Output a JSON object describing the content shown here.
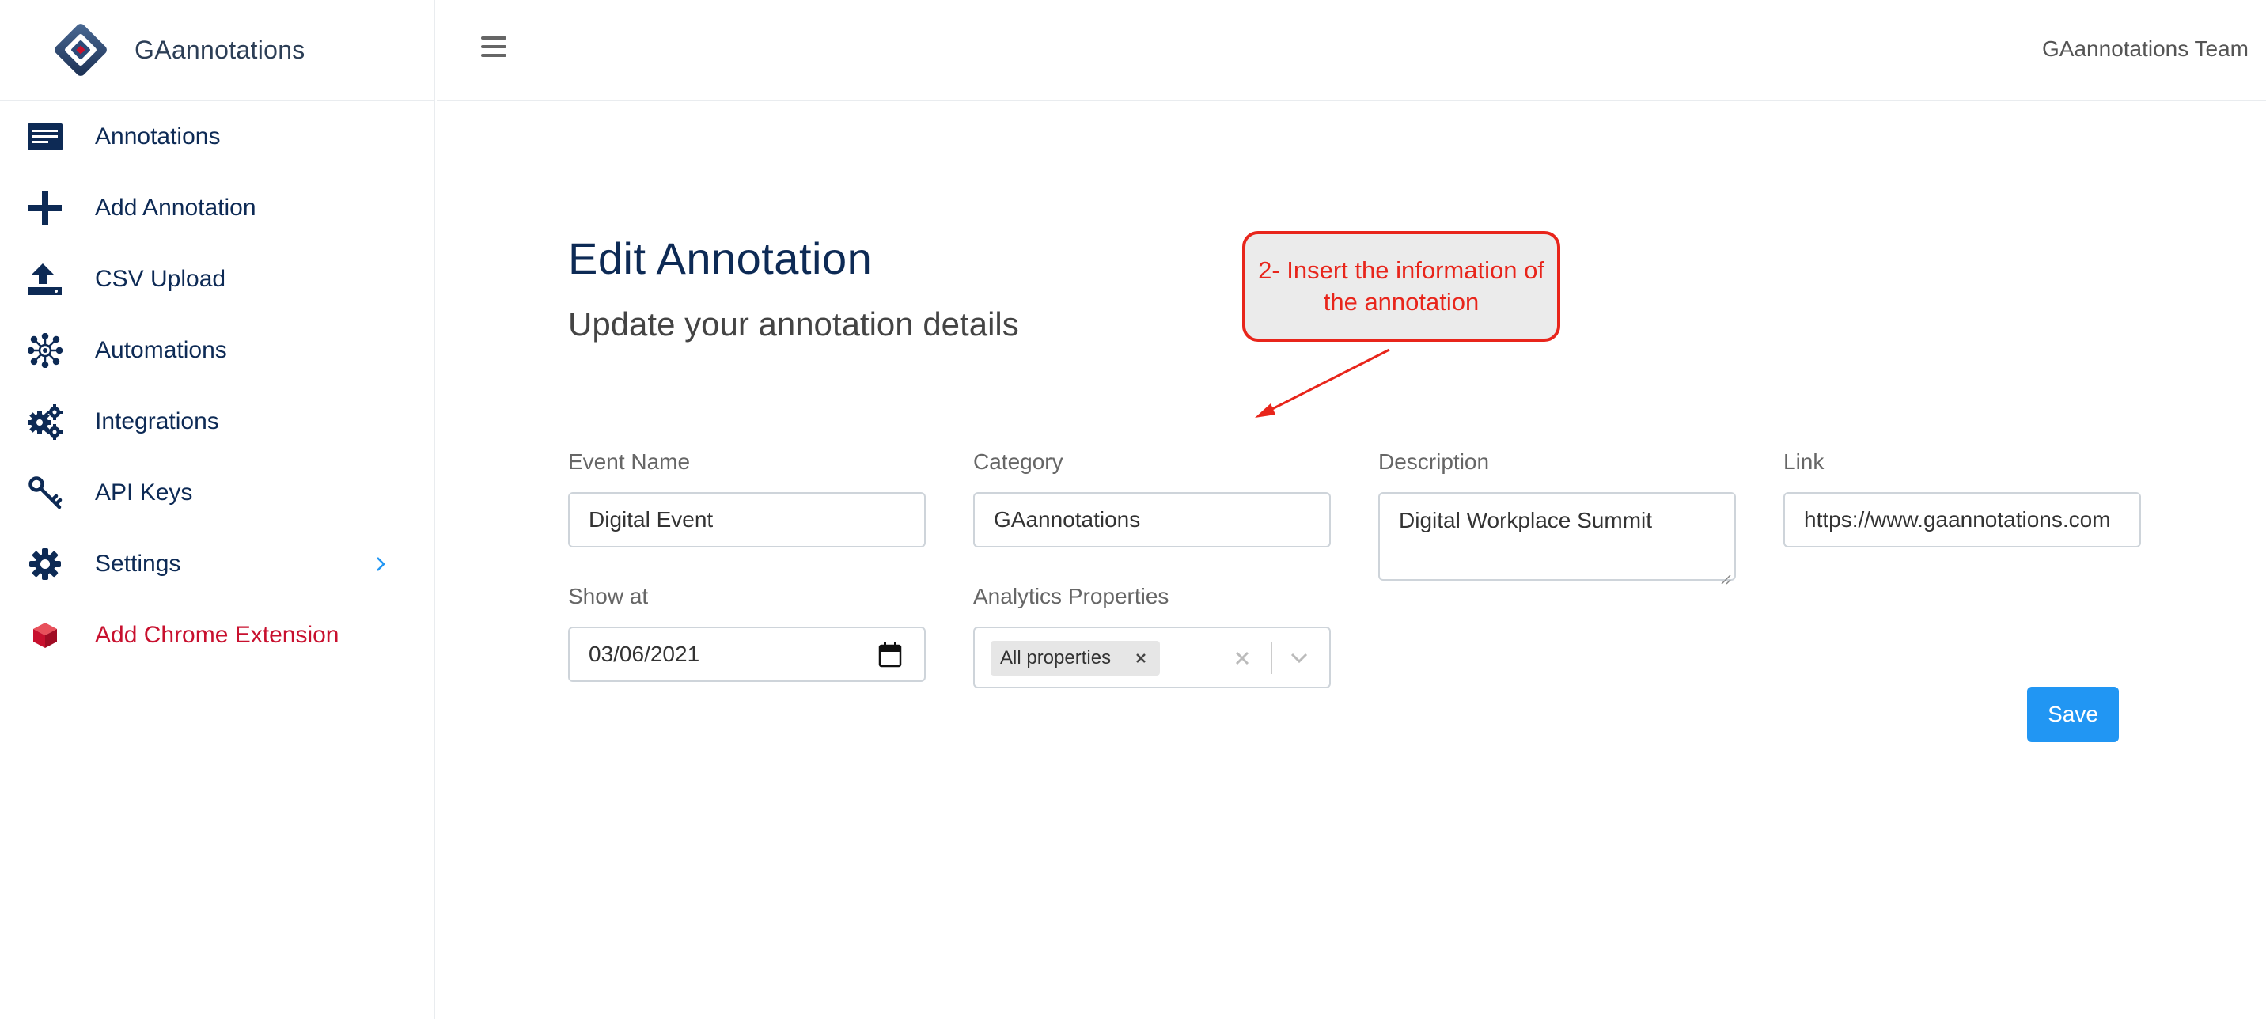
{
  "app": {
    "brand_name": "GAannotations",
    "team_name": "GAannotations Team"
  },
  "sidebar": {
    "items": [
      {
        "label": "Annotations",
        "icon": "list-icon"
      },
      {
        "label": "Add Annotation",
        "icon": "plus-icon"
      },
      {
        "label": "CSV Upload",
        "icon": "upload-icon"
      },
      {
        "label": "Automations",
        "icon": "network-icon"
      },
      {
        "label": "Integrations",
        "icon": "gears-icon"
      },
      {
        "label": "API Keys",
        "icon": "key-icon"
      },
      {
        "label": "Settings",
        "icon": "gear-icon"
      },
      {
        "label": "Add Chrome Extension",
        "icon": "cube-icon"
      }
    ]
  },
  "page": {
    "title": "Edit Annotation",
    "subtitle": "Update your annotation details"
  },
  "form": {
    "event_name": {
      "label": "Event Name",
      "value": "Digital Event"
    },
    "category": {
      "label": "Category",
      "value": "GAannotations"
    },
    "description": {
      "label": "Description",
      "value": "Digital Workplace Summit"
    },
    "link": {
      "label": "Link",
      "value": "https://www.gaannotations.com"
    },
    "show_at": {
      "label": "Show at",
      "value": "03/06/2021"
    },
    "analytics_properties": {
      "label": "Analytics Properties",
      "selected": [
        "All properties"
      ]
    },
    "save_label": "Save"
  },
  "callout": {
    "text": "2- Insert the information of the annotation"
  },
  "colors": {
    "primary": "#2196f3",
    "navy": "#0d2a55",
    "danger": "#c8102e",
    "callout": "#e8251b"
  }
}
